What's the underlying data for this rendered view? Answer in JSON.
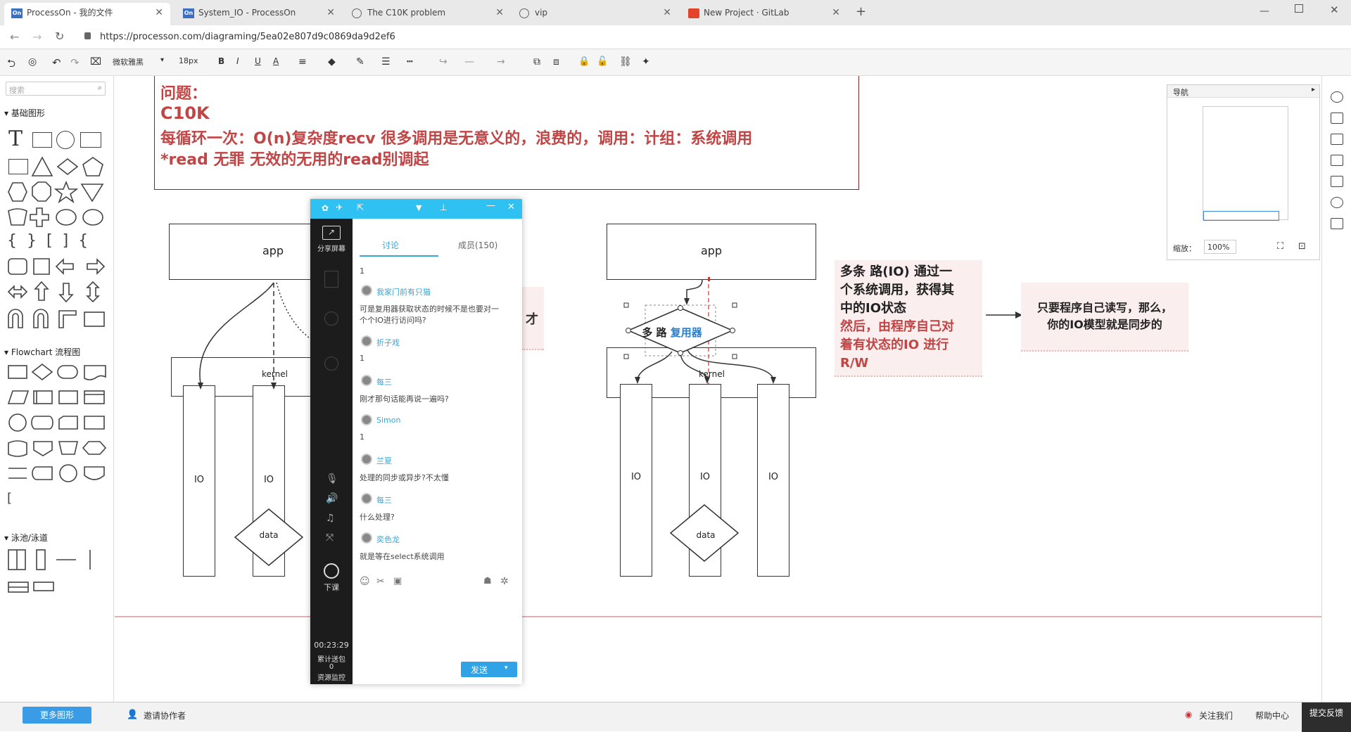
{
  "tabs": [
    {
      "title": "ProcessOn - 我的文件",
      "icon": "On"
    },
    {
      "title": "System_IO - ProcessOn",
      "icon": "On"
    },
    {
      "title": "The C10K problem",
      "icon": "globe"
    },
    {
      "title": "vip",
      "icon": "globe"
    },
    {
      "title": "New Project · GitLab",
      "icon": "gitlab"
    }
  ],
  "address": {
    "url": "https://processon.com/diagraming/5ea02e807d9c0869da9d2ef6"
  },
  "toolbar": {
    "font": "微软雅黑",
    "size": "18px",
    "bold": "B",
    "italic": "I",
    "underline": "U",
    "fontcolor": "A"
  },
  "left": {
    "search_placeholder": "搜索",
    "basic": "基础图形",
    "flowchart": "Flowchart 流程图",
    "swimlane": "泳池/泳道",
    "more_shapes": "更多图形",
    "invite": "邀请协作者"
  },
  "canvas": {
    "top_lines": [
      "问题：",
      "C10K",
      "每循环一次：O(n)复杂度recv  很多调用是无意义的，浪费的，调用：计组：系统调用",
      "*read  无罪  无效的无用的read别调起"
    ],
    "left_diagram": {
      "app": "app",
      "kernel": "kernel",
      "io1": "IO",
      "io2": "IO",
      "data": "data",
      "sticky_char": "才"
    },
    "right_diagram": {
      "app": "app",
      "kernel": "kernel",
      "io1": "IO",
      "io2": "IO",
      "io3": "IO",
      "data": "data",
      "diamond_prefix": "多 路 ",
      "diamond_highlight": "复用器"
    },
    "note1_lines": [
      "多条 路(IO) 通过一",
      "个系统调用，获得其",
      "中的IO状态",
      "然后，由程序自己对",
      "着有状态的IO 进行",
      "R/W"
    ],
    "note2_lines": [
      "只要程序自己读写，那么，",
      "你的IO模型就是同步的"
    ]
  },
  "chat": {
    "share_screen": "分享屏幕",
    "tab_discussion": "讨论",
    "tab_members": "成员(150)",
    "end_class": "下课",
    "timer": "00:23:29",
    "gift": "累计送包",
    "gift_count": "0",
    "resource": "资源监控",
    "send": "发送",
    "messages": [
      {
        "user": "",
        "text": "1"
      },
      {
        "user": "我家门前有只猫",
        "text": "可是复用器获取状态的时候不是也要对一"
      },
      {
        "user": "",
        "text": "个个IO进行访问吗?"
      },
      {
        "user": "折子戏",
        "text": "1"
      },
      {
        "user": "每三",
        "text": "刚才那句话能再说一遍吗?"
      },
      {
        "user": "Simon",
        "text": "1"
      },
      {
        "user": "兰夏",
        "text": "处理的同步或异步?不太懂"
      },
      {
        "user": "每三",
        "text": "什么处理?"
      },
      {
        "user": "奕色龙",
        "text": "就是等在select系统调用"
      }
    ]
  },
  "nav": {
    "title": "导航",
    "zoom_label": "缩放：",
    "zoom": "100%"
  },
  "bottom": {
    "follow": "关注我们",
    "help": "帮助中心",
    "feedback": "提交反馈"
  }
}
